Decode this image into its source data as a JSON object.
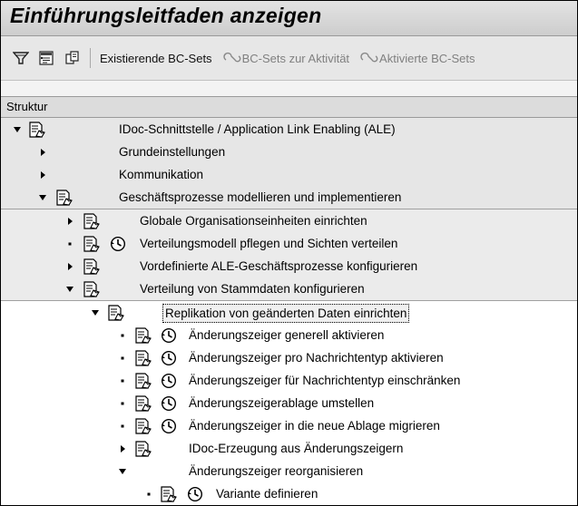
{
  "window": {
    "title": "Einführungsleitfaden anzeigen"
  },
  "toolbar": {
    "icons": [
      "filter-icon",
      "info-legend-icon",
      "where-used-icon"
    ],
    "existing_bc_sets": "Existierende BC-Sets",
    "bc_sets_activity": "BC-Sets zur Aktivität",
    "activated_bc_sets": "Aktivierte BC-Sets"
  },
  "tree": {
    "header": "Struktur",
    "rows": [
      {
        "label": "IDoc-Schnittstelle / Application Link Enabling (ALE)",
        "toggle": "expanded",
        "doc": true,
        "clock": false
      },
      {
        "label": "Grundeinstellungen",
        "toggle": "collapsed",
        "doc": false,
        "clock": false
      },
      {
        "label": "Kommunikation",
        "toggle": "collapsed",
        "doc": false,
        "clock": false
      },
      {
        "label": "Geschäftsprozesse modellieren und implementieren",
        "toggle": "expanded",
        "doc": true,
        "clock": false
      },
      {
        "label": "Globale Organisationseinheiten einrichten",
        "toggle": "collapsed",
        "doc": true,
        "clock": false
      },
      {
        "label": "Verteilungsmodell pflegen und Sichten verteilen",
        "toggle": "leaf",
        "doc": true,
        "clock": true
      },
      {
        "label": "Vordefinierte ALE-Geschäftsprozesse konfigurieren",
        "toggle": "collapsed",
        "doc": true,
        "clock": false
      },
      {
        "label": "Verteilung von Stammdaten konfigurieren",
        "toggle": "expanded",
        "doc": true,
        "clock": false
      },
      {
        "label": "Replikation von geänderten Daten einrichten",
        "toggle": "expanded",
        "doc": true,
        "clock": false,
        "selected": true
      },
      {
        "label": "Änderungszeiger generell aktivieren",
        "toggle": "leaf",
        "doc": true,
        "clock": true
      },
      {
        "label": "Änderungszeiger pro Nachrichtentyp aktivieren",
        "toggle": "leaf",
        "doc": true,
        "clock": true
      },
      {
        "label": "Änderungszeiger für Nachrichtentyp einschränken",
        "toggle": "leaf",
        "doc": true,
        "clock": true
      },
      {
        "label": "Änderungszeigerablage umstellen",
        "toggle": "leaf",
        "doc": true,
        "clock": true
      },
      {
        "label": "Änderungszeiger in die neue Ablage migrieren",
        "toggle": "leaf",
        "doc": true,
        "clock": true
      },
      {
        "label": "IDoc-Erzeugung aus Änderungszeigern",
        "toggle": "collapsed",
        "doc": true,
        "clock": false
      },
      {
        "label": "Änderungszeiger reorganisieren",
        "toggle": "expanded",
        "doc": false,
        "clock": false
      },
      {
        "label": "Variante definieren",
        "toggle": "leaf",
        "doc": true,
        "clock": true
      }
    ]
  }
}
